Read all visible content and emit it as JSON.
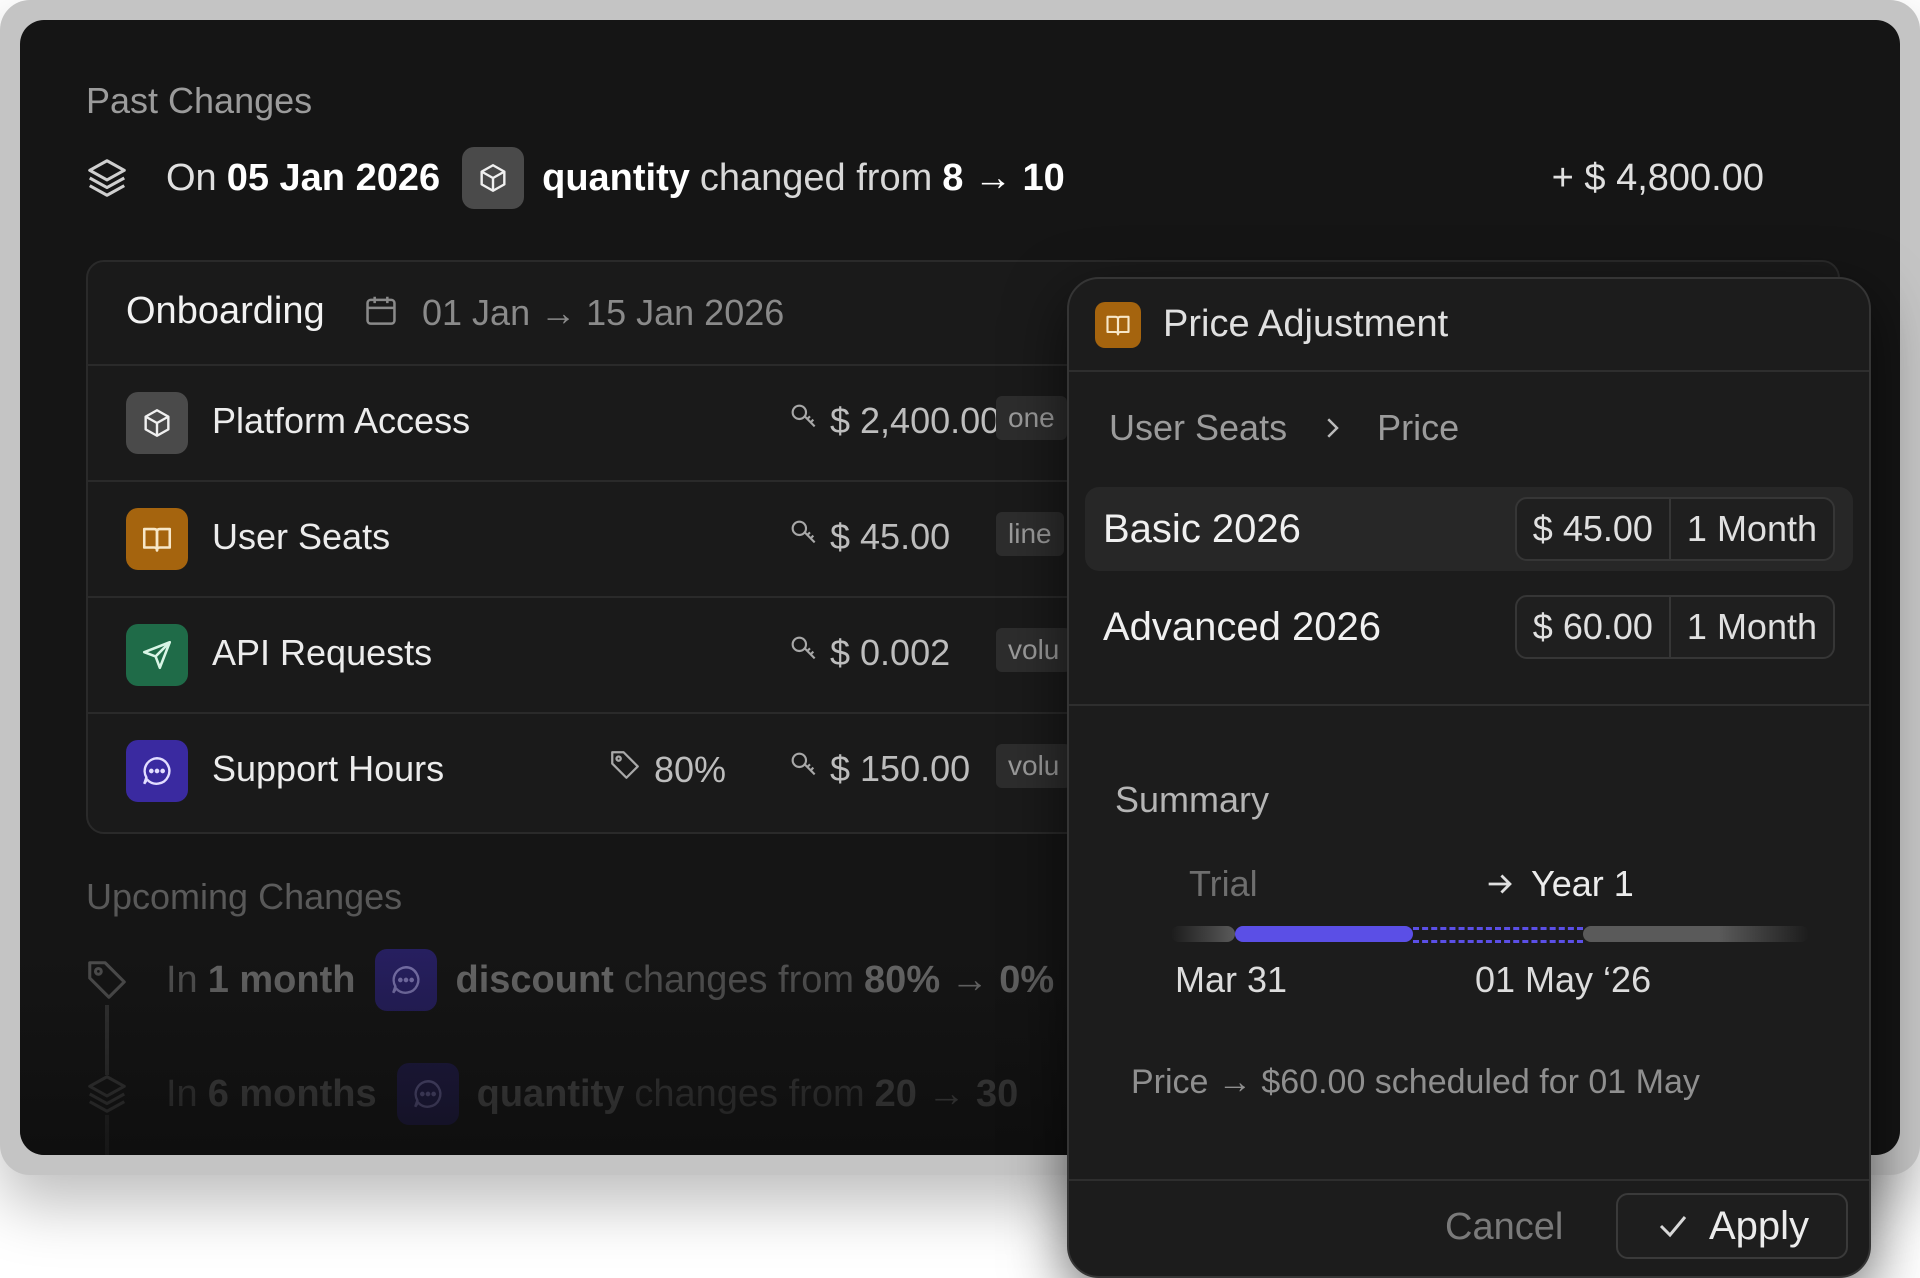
{
  "past": {
    "title": "Past Changes",
    "change": {
      "prefix": "On",
      "date": "05 Jan 2026",
      "field": "quantity",
      "verb": "changed from",
      "from_to": "8 → 10",
      "amount": "+ $ 4,800.00"
    }
  },
  "onboarding": {
    "title": "Onboarding",
    "dates": "01 Jan → 15 Jan 2026",
    "items": [
      {
        "name": "Platform Access",
        "price": "$ 2,400.00",
        "tag": "one",
        "icon": "cube-icon",
        "color": "#4a4a4a"
      },
      {
        "name": "User Seats",
        "price": "$ 45.00",
        "tag": "line",
        "icon": "book-icon",
        "color": "#a5640e"
      },
      {
        "name": "API Requests",
        "price": "$ 0.002",
        "tag": "volu",
        "icon": "send-icon",
        "color": "#1f6b48"
      },
      {
        "name": "Support Hours",
        "discount": "80%",
        "price": "$ 150.00",
        "tag": "volu",
        "icon": "chat-icon",
        "color": "#3a2aa0"
      }
    ]
  },
  "upcoming": {
    "title": "Upcoming Changes",
    "changes": [
      {
        "prefix": "In",
        "when": "1 month",
        "field": "discount",
        "verb": "changes from",
        "from_to": "80% → 0%"
      },
      {
        "prefix": "In",
        "when": "6 months",
        "field": "quantity",
        "verb": "changes from",
        "from_to": "20 → 30"
      }
    ]
  },
  "popover": {
    "title": "Price Adjustment",
    "breadcrumb": [
      "User Seats",
      "Price"
    ],
    "options": [
      {
        "name": "Basic 2026",
        "price": "$ 45.00",
        "period": "1 Month",
        "selected": true
      },
      {
        "name": "Advanced 2026",
        "price": "$ 60.00",
        "period": "1 Month",
        "selected": false
      }
    ],
    "summary": {
      "title": "Summary",
      "phase_from": "Trial",
      "phase_to": "Year 1",
      "date_start": "Mar 31",
      "date_change": "01 May ‘26",
      "note": "Price → $60.00 scheduled for 01 May"
    },
    "cancel_label": "Cancel",
    "apply_label": "Apply"
  },
  "colors": {
    "accent": "#5b4fe6",
    "amber": "#a5640e",
    "green": "#1f6b48",
    "purple": "#3a2aa0"
  }
}
